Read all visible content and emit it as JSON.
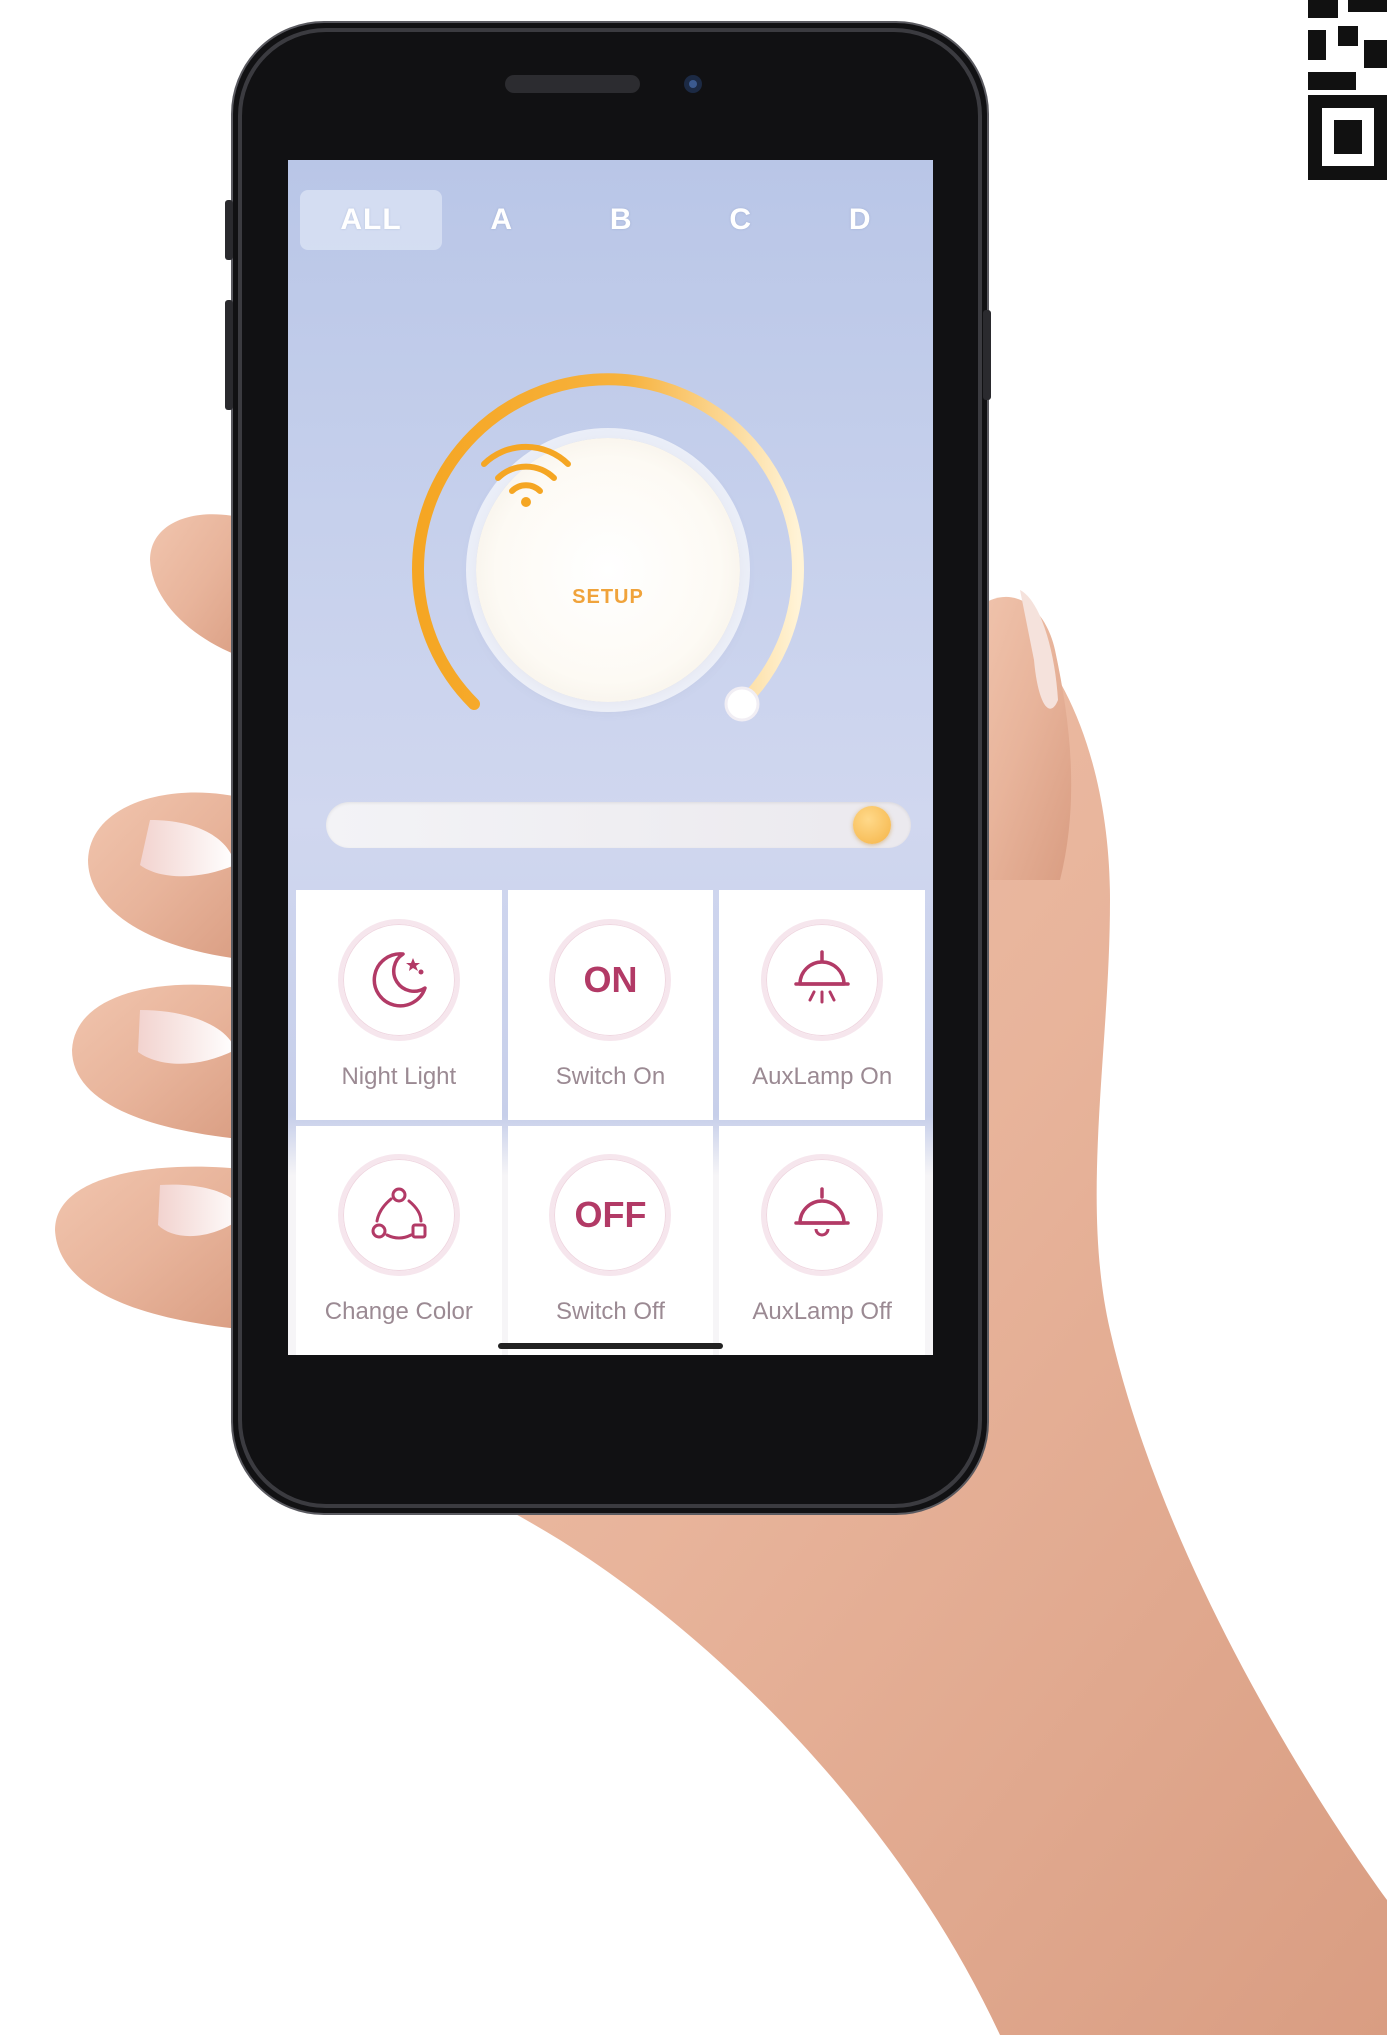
{
  "tabs": [
    "ALL",
    "A",
    "B",
    "C",
    "D"
  ],
  "active_tab": 0,
  "dial": {
    "label": "SETUP",
    "icon": "wifi-icon"
  },
  "brightness_slider": {
    "level": 0.97
  },
  "actions": [
    {
      "label": "Night Light",
      "icon": "moon-icon"
    },
    {
      "label": "Switch On",
      "icon": "on-icon",
      "icon_text": "ON"
    },
    {
      "label": "AuxLamp On",
      "icon": "lamp-on-icon"
    },
    {
      "label": "Change Color",
      "icon": "color-cycle-icon"
    },
    {
      "label": "Switch Off",
      "icon": "off-icon",
      "icon_text": "OFF"
    },
    {
      "label": "AuxLamp Off",
      "icon": "lamp-off-icon"
    }
  ],
  "colors": {
    "accent": "#f5a623",
    "action": "#b23a66",
    "screen_bg": "#c3cdea"
  }
}
